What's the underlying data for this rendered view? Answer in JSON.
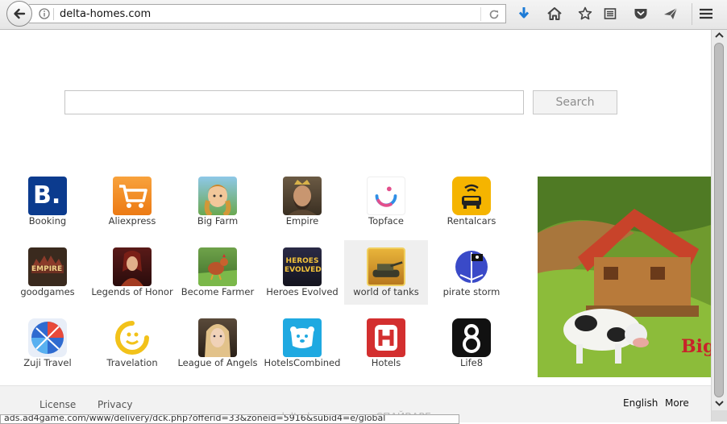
{
  "browser": {
    "url": "delta-homes.com"
  },
  "search": {
    "value": "",
    "button_label": "Search"
  },
  "tiles": [
    {
      "label": "Booking"
    },
    {
      "label": "Aliexpress"
    },
    {
      "label": "Big Farm"
    },
    {
      "label": "Empire"
    },
    {
      "label": "Topface"
    },
    {
      "label": "Rentalcars"
    },
    {
      "label": "goodgames"
    },
    {
      "label": "Legends of Honor"
    },
    {
      "label": "Become Farmer"
    },
    {
      "label": "Heroes Evolved"
    },
    {
      "label": "world of tanks"
    },
    {
      "label": "pirate storm"
    },
    {
      "label": "Zuji Travel"
    },
    {
      "label": "Travelation"
    },
    {
      "label": "League of Angels"
    },
    {
      "label": "HotelsCombined"
    },
    {
      "label": "Hotels"
    },
    {
      "label": "Life8"
    }
  ],
  "icons": {
    "booking_letter": "B.",
    "goodgames_text": "EMPIRE",
    "heroes_text": "HEROES EVOLVED",
    "ad_text": "Big"
  },
  "footer": {
    "license": "License",
    "privacy": "Privacy",
    "watermark": "delta-homes.com - СПАЙВАРЕ.ру",
    "english": "English",
    "more": "More"
  },
  "statusbar": {
    "text": "ads.ad4game.com/www/delivery/dck.php?offerid=33&zoneid=5916&subid4=e/global"
  },
  "colors": {
    "booking": "#0b3b8e",
    "aliexpress": "#f08a24",
    "rentalcars": "#f5b400",
    "topface": "#ffffff",
    "hotelscombined": "#1fa9e1",
    "hotels": "#d32f2f",
    "life8": "#111111"
  }
}
